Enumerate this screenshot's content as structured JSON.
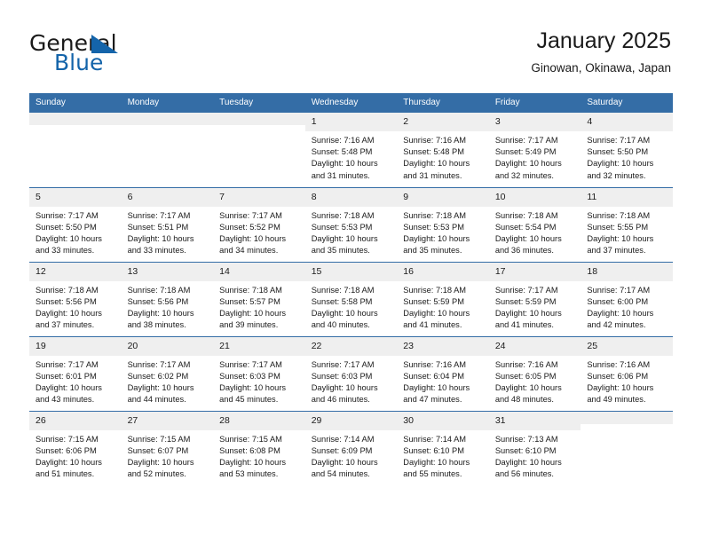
{
  "brand": {
    "name_part1": "General",
    "name_part2": "Blue",
    "flag_color": "#1464aa"
  },
  "header": {
    "title": "January 2025",
    "location": "Ginowan, Okinawa, Japan"
  },
  "theme": {
    "header_blue": "#346DA6",
    "daynum_bg": "#efefef",
    "text": "#1a1a1a"
  },
  "calendar": {
    "weekday_headers": [
      "Sunday",
      "Monday",
      "Tuesday",
      "Wednesday",
      "Thursday",
      "Friday",
      "Saturday"
    ],
    "weeks": [
      [
        {
          "day": "",
          "blank": true,
          "sunrise": "",
          "sunset": "",
          "daylight1": "",
          "daylight2": ""
        },
        {
          "day": "",
          "blank": true,
          "sunrise": "",
          "sunset": "",
          "daylight1": "",
          "daylight2": ""
        },
        {
          "day": "",
          "blank": true,
          "sunrise": "",
          "sunset": "",
          "daylight1": "",
          "daylight2": ""
        },
        {
          "day": "1",
          "blank": false,
          "sunrise": "Sunrise: 7:16 AM",
          "sunset": "Sunset: 5:48 PM",
          "daylight1": "Daylight: 10 hours",
          "daylight2": "and 31 minutes."
        },
        {
          "day": "2",
          "blank": false,
          "sunrise": "Sunrise: 7:16 AM",
          "sunset": "Sunset: 5:48 PM",
          "daylight1": "Daylight: 10 hours",
          "daylight2": "and 31 minutes."
        },
        {
          "day": "3",
          "blank": false,
          "sunrise": "Sunrise: 7:17 AM",
          "sunset": "Sunset: 5:49 PM",
          "daylight1": "Daylight: 10 hours",
          "daylight2": "and 32 minutes."
        },
        {
          "day": "4",
          "blank": false,
          "sunrise": "Sunrise: 7:17 AM",
          "sunset": "Sunset: 5:50 PM",
          "daylight1": "Daylight: 10 hours",
          "daylight2": "and 32 minutes."
        }
      ],
      [
        {
          "day": "5",
          "blank": false,
          "sunrise": "Sunrise: 7:17 AM",
          "sunset": "Sunset: 5:50 PM",
          "daylight1": "Daylight: 10 hours",
          "daylight2": "and 33 minutes."
        },
        {
          "day": "6",
          "blank": false,
          "sunrise": "Sunrise: 7:17 AM",
          "sunset": "Sunset: 5:51 PM",
          "daylight1": "Daylight: 10 hours",
          "daylight2": "and 33 minutes."
        },
        {
          "day": "7",
          "blank": false,
          "sunrise": "Sunrise: 7:17 AM",
          "sunset": "Sunset: 5:52 PM",
          "daylight1": "Daylight: 10 hours",
          "daylight2": "and 34 minutes."
        },
        {
          "day": "8",
          "blank": false,
          "sunrise": "Sunrise: 7:18 AM",
          "sunset": "Sunset: 5:53 PM",
          "daylight1": "Daylight: 10 hours",
          "daylight2": "and 35 minutes."
        },
        {
          "day": "9",
          "blank": false,
          "sunrise": "Sunrise: 7:18 AM",
          "sunset": "Sunset: 5:53 PM",
          "daylight1": "Daylight: 10 hours",
          "daylight2": "and 35 minutes."
        },
        {
          "day": "10",
          "blank": false,
          "sunrise": "Sunrise: 7:18 AM",
          "sunset": "Sunset: 5:54 PM",
          "daylight1": "Daylight: 10 hours",
          "daylight2": "and 36 minutes."
        },
        {
          "day": "11",
          "blank": false,
          "sunrise": "Sunrise: 7:18 AM",
          "sunset": "Sunset: 5:55 PM",
          "daylight1": "Daylight: 10 hours",
          "daylight2": "and 37 minutes."
        }
      ],
      [
        {
          "day": "12",
          "blank": false,
          "sunrise": "Sunrise: 7:18 AM",
          "sunset": "Sunset: 5:56 PM",
          "daylight1": "Daylight: 10 hours",
          "daylight2": "and 37 minutes."
        },
        {
          "day": "13",
          "blank": false,
          "sunrise": "Sunrise: 7:18 AM",
          "sunset": "Sunset: 5:56 PM",
          "daylight1": "Daylight: 10 hours",
          "daylight2": "and 38 minutes."
        },
        {
          "day": "14",
          "blank": false,
          "sunrise": "Sunrise: 7:18 AM",
          "sunset": "Sunset: 5:57 PM",
          "daylight1": "Daylight: 10 hours",
          "daylight2": "and 39 minutes."
        },
        {
          "day": "15",
          "blank": false,
          "sunrise": "Sunrise: 7:18 AM",
          "sunset": "Sunset: 5:58 PM",
          "daylight1": "Daylight: 10 hours",
          "daylight2": "and 40 minutes."
        },
        {
          "day": "16",
          "blank": false,
          "sunrise": "Sunrise: 7:18 AM",
          "sunset": "Sunset: 5:59 PM",
          "daylight1": "Daylight: 10 hours",
          "daylight2": "and 41 minutes."
        },
        {
          "day": "17",
          "blank": false,
          "sunrise": "Sunrise: 7:17 AM",
          "sunset": "Sunset: 5:59 PM",
          "daylight1": "Daylight: 10 hours",
          "daylight2": "and 41 minutes."
        },
        {
          "day": "18",
          "blank": false,
          "sunrise": "Sunrise: 7:17 AM",
          "sunset": "Sunset: 6:00 PM",
          "daylight1": "Daylight: 10 hours",
          "daylight2": "and 42 minutes."
        }
      ],
      [
        {
          "day": "19",
          "blank": false,
          "sunrise": "Sunrise: 7:17 AM",
          "sunset": "Sunset: 6:01 PM",
          "daylight1": "Daylight: 10 hours",
          "daylight2": "and 43 minutes."
        },
        {
          "day": "20",
          "blank": false,
          "sunrise": "Sunrise: 7:17 AM",
          "sunset": "Sunset: 6:02 PM",
          "daylight1": "Daylight: 10 hours",
          "daylight2": "and 44 minutes."
        },
        {
          "day": "21",
          "blank": false,
          "sunrise": "Sunrise: 7:17 AM",
          "sunset": "Sunset: 6:03 PM",
          "daylight1": "Daylight: 10 hours",
          "daylight2": "and 45 minutes."
        },
        {
          "day": "22",
          "blank": false,
          "sunrise": "Sunrise: 7:17 AM",
          "sunset": "Sunset: 6:03 PM",
          "daylight1": "Daylight: 10 hours",
          "daylight2": "and 46 minutes."
        },
        {
          "day": "23",
          "blank": false,
          "sunrise": "Sunrise: 7:16 AM",
          "sunset": "Sunset: 6:04 PM",
          "daylight1": "Daylight: 10 hours",
          "daylight2": "and 47 minutes."
        },
        {
          "day": "24",
          "blank": false,
          "sunrise": "Sunrise: 7:16 AM",
          "sunset": "Sunset: 6:05 PM",
          "daylight1": "Daylight: 10 hours",
          "daylight2": "and 48 minutes."
        },
        {
          "day": "25",
          "blank": false,
          "sunrise": "Sunrise: 7:16 AM",
          "sunset": "Sunset: 6:06 PM",
          "daylight1": "Daylight: 10 hours",
          "daylight2": "and 49 minutes."
        }
      ],
      [
        {
          "day": "26",
          "blank": false,
          "sunrise": "Sunrise: 7:15 AM",
          "sunset": "Sunset: 6:06 PM",
          "daylight1": "Daylight: 10 hours",
          "daylight2": "and 51 minutes."
        },
        {
          "day": "27",
          "blank": false,
          "sunrise": "Sunrise: 7:15 AM",
          "sunset": "Sunset: 6:07 PM",
          "daylight1": "Daylight: 10 hours",
          "daylight2": "and 52 minutes."
        },
        {
          "day": "28",
          "blank": false,
          "sunrise": "Sunrise: 7:15 AM",
          "sunset": "Sunset: 6:08 PM",
          "daylight1": "Daylight: 10 hours",
          "daylight2": "and 53 minutes."
        },
        {
          "day": "29",
          "blank": false,
          "sunrise": "Sunrise: 7:14 AM",
          "sunset": "Sunset: 6:09 PM",
          "daylight1": "Daylight: 10 hours",
          "daylight2": "and 54 minutes."
        },
        {
          "day": "30",
          "blank": false,
          "sunrise": "Sunrise: 7:14 AM",
          "sunset": "Sunset: 6:10 PM",
          "daylight1": "Daylight: 10 hours",
          "daylight2": "and 55 minutes."
        },
        {
          "day": "31",
          "blank": false,
          "sunrise": "Sunrise: 7:13 AM",
          "sunset": "Sunset: 6:10 PM",
          "daylight1": "Daylight: 10 hours",
          "daylight2": "and 56 minutes."
        },
        {
          "day": "",
          "blank": true,
          "sunrise": "",
          "sunset": "",
          "daylight1": "",
          "daylight2": ""
        }
      ]
    ]
  }
}
